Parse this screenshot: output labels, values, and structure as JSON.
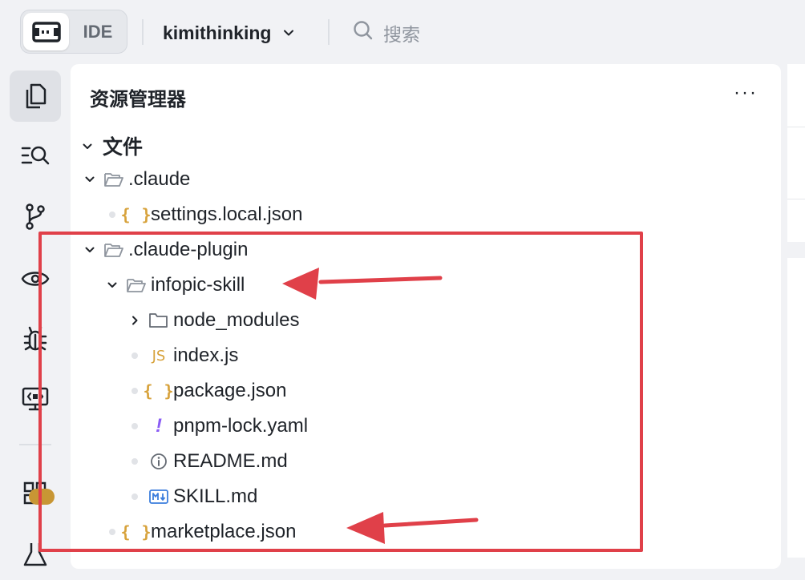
{
  "topbar": {
    "mode_label": "IDE",
    "project_name": "kimithinking",
    "search_label": "搜索"
  },
  "explorer": {
    "title": "资源管理器",
    "more_label": "···",
    "section_label": "文件",
    "rows": [
      {
        "name": ".claude",
        "type": "folder-open"
      },
      {
        "name": "settings.local.json",
        "type": "json"
      },
      {
        "name": ".claude-plugin",
        "type": "folder-open"
      },
      {
        "name": "infopic-skill",
        "type": "folder-open"
      },
      {
        "name": "node_modules",
        "type": "folder-closed"
      },
      {
        "name": "index.js",
        "type": "js"
      },
      {
        "name": "package.json",
        "type": "json"
      },
      {
        "name": "pnpm-lock.yaml",
        "type": "yaml"
      },
      {
        "name": "README.md",
        "type": "info"
      },
      {
        "name": "SKILL.md",
        "type": "markdown"
      },
      {
        "name": "marketplace.json",
        "type": "json"
      }
    ]
  },
  "icons": {
    "json": "{ }",
    "js": "JS",
    "yaml": "!"
  },
  "colors": {
    "annotation": "#e04049",
    "json_icon": "#d7a23b",
    "yaml_icon": "#8a5cf5",
    "markdown_icon": "#3b7ddd",
    "badge": "#c89634"
  }
}
